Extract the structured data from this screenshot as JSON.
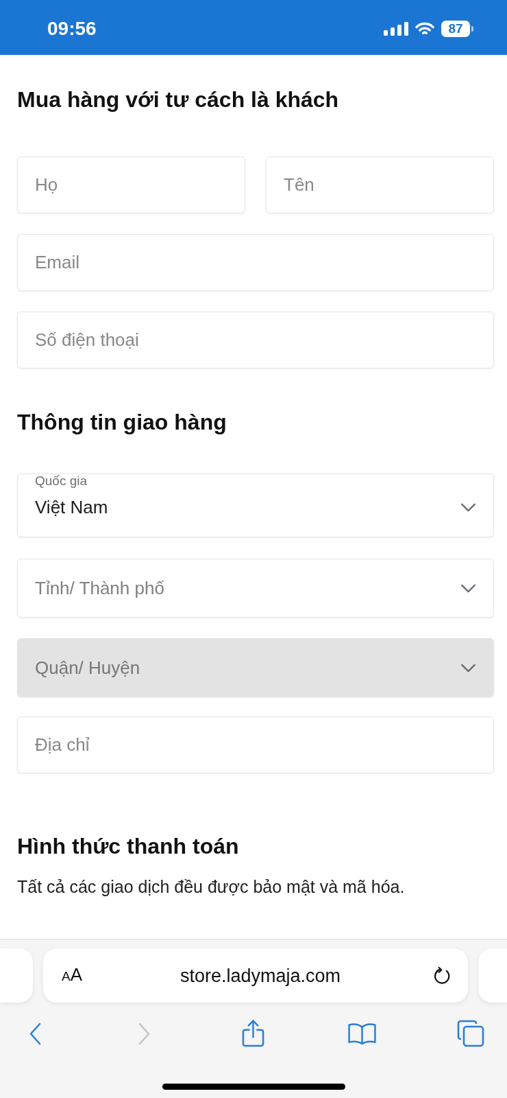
{
  "status_bar": {
    "time": "09:56",
    "battery": "87"
  },
  "guest": {
    "title": "Mua hàng với tư cách là khách",
    "name_fields": [
      {
        "placeholder": "Họ"
      },
      {
        "placeholder": "Tên"
      }
    ],
    "fields": [
      {
        "placeholder": "Email"
      },
      {
        "placeholder": "Số điện thoại"
      }
    ]
  },
  "shipping": {
    "title": "Thông tin giao hàng",
    "fields": [
      {
        "kind": "select",
        "label": "Quốc gia",
        "value": "Việt Nam",
        "disabled": false
      },
      {
        "kind": "select",
        "placeholder": "Tỉnh/ Thành phố",
        "disabled": false
      },
      {
        "kind": "select",
        "placeholder": "Quận/ Huyện",
        "disabled": true
      },
      {
        "kind": "text",
        "placeholder": "Địa chỉ",
        "disabled": false
      }
    ]
  },
  "payment": {
    "title": "Hình thức thanh toán",
    "note": "Tất cả các giao dịch đều được bảo mật và mã hóa."
  },
  "browser": {
    "text_size": "AA",
    "url": "store.ladymaja.com",
    "toolbar": {
      "back": {
        "disabled": false
      },
      "forward": {
        "disabled": true
      }
    }
  }
}
